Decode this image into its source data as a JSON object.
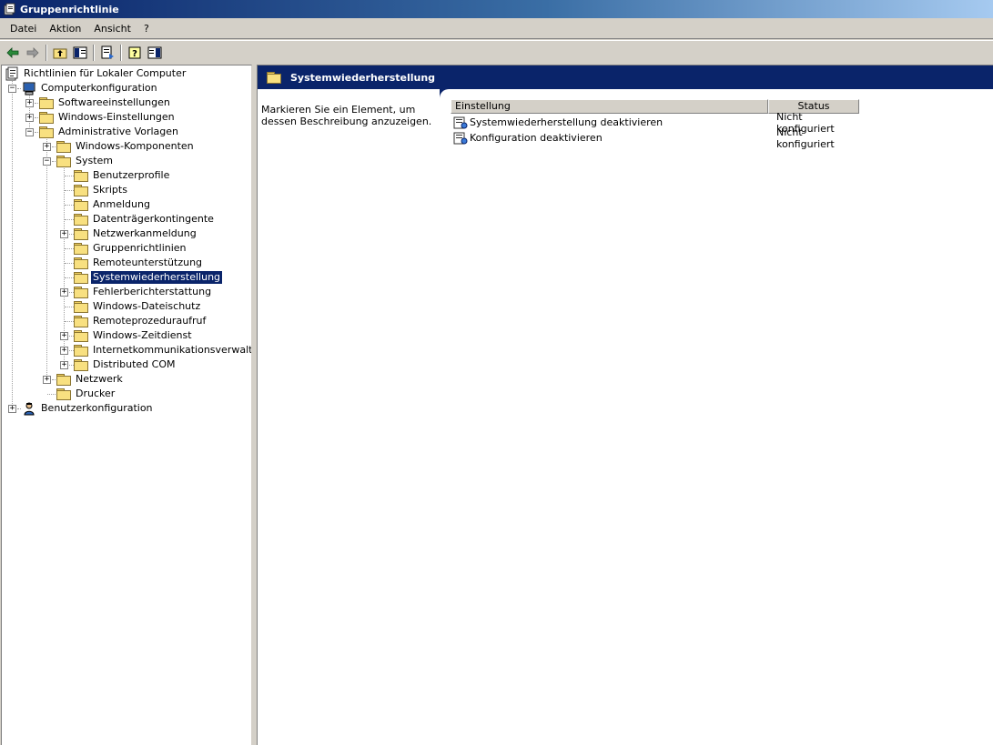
{
  "window": {
    "title": "Gruppenrichtlinie"
  },
  "menu": [
    "Datei",
    "Aktion",
    "Ansicht",
    "?"
  ],
  "toolbar": {
    "buttons": [
      "back-icon",
      "forward-icon",
      "up-folder-icon",
      "show-hide-tree-icon",
      "export-list-icon",
      "help-icon",
      "show-hide-description-icon"
    ]
  },
  "tree": {
    "root": "Richtlinien für Lokaler Computer",
    "computer": "Computerkonfiguration",
    "software": "Softwareeinstellungen",
    "windows_settings": "Windows-Einstellungen",
    "admin_templates": "Administrative Vorlagen",
    "windows_components": "Windows-Komponenten",
    "system": "System",
    "system_children": [
      "Benutzerprofile",
      "Skripts",
      "Anmeldung",
      "Datenträgerkontingente",
      "Netzwerkanmeldung",
      "Gruppenrichtlinien",
      "Remoteunterstützung",
      "Systemwiederherstellung",
      "Fehlerberichterstattung",
      "Windows-Dateischutz",
      "Remoteprozeduraufruf",
      "Windows-Zeitdienst",
      "Internetkommunikationsverwaltung",
      "Distributed COM"
    ],
    "network": "Netzwerk",
    "printers": "Drucker",
    "user": "Benutzerkonfiguration"
  },
  "detail": {
    "header": "Systemwiederherstellung",
    "description": "Markieren Sie ein Element, um dessen Beschreibung anzuzeigen.",
    "columns": [
      "Einstellung",
      "Status"
    ],
    "rows": [
      {
        "setting": "Systemwiederherstellung deaktivieren",
        "status": "Nicht konfiguriert"
      },
      {
        "setting": "Konfiguration deaktivieren",
        "status": "Nicht konfiguriert"
      }
    ]
  },
  "colors": {
    "selection": "#0a246a",
    "title_gradient_end": "#a6caf0"
  }
}
